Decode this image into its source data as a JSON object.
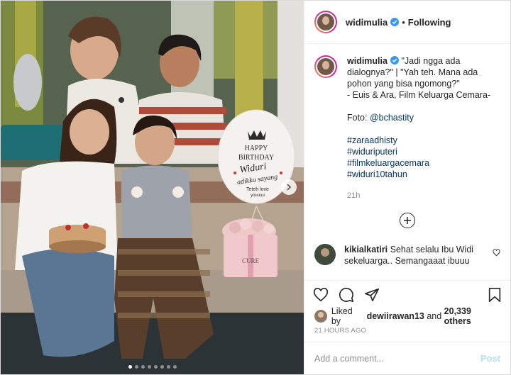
{
  "header": {
    "username": "widimulia",
    "follow_status": "Following",
    "separator": "•"
  },
  "caption": {
    "username": "widimulia",
    "text": "\"Jadi ngga ada dialognya?\" | \"Yah teh. Mana ada pohon yang bisa ngomong?\"\n- Euis & Ara, Film Keluarga Cemara-",
    "photo_credit_prefix": "Foto: ",
    "photo_credit_handle": "@bchastity",
    "hashtags": [
      "#zaraadhisty",
      "#widuriputeri",
      "#filmkeluargacemara",
      "#widuri10tahun"
    ],
    "time": "21h"
  },
  "comment": {
    "username": "kikialkatiri",
    "text": "Sehat selalu Ibu Widi sekeluarga.. Semangaaat ibuuu"
  },
  "likes": {
    "prefix": "Liked by ",
    "user": "dewiirawan13",
    "middle": " and ",
    "count": "20,339 others"
  },
  "posted_time": "21 HOURS AGO",
  "add_comment": {
    "placeholder": "Add a comment...",
    "post_label": "Post"
  },
  "balloon": {
    "line1": "HAPPY",
    "line2": "BIRTHDAY",
    "line3": "Widuri",
    "line4": "adikku sayang",
    "line5": "Teteh love",
    "line6": "youuuu"
  },
  "box_label": "CURE",
  "carousel": {
    "total_dots": 8,
    "active_index": 0
  },
  "colors": {
    "link": "#00376b",
    "verified": "#3897f0",
    "post_disabled": "#b2dffc",
    "muted": "#8e8e8e"
  },
  "icons": [
    "verified-badge-icon",
    "chevron-right-icon",
    "plus-circle-icon",
    "heart-icon",
    "comment-icon",
    "share-icon",
    "bookmark-icon"
  ]
}
